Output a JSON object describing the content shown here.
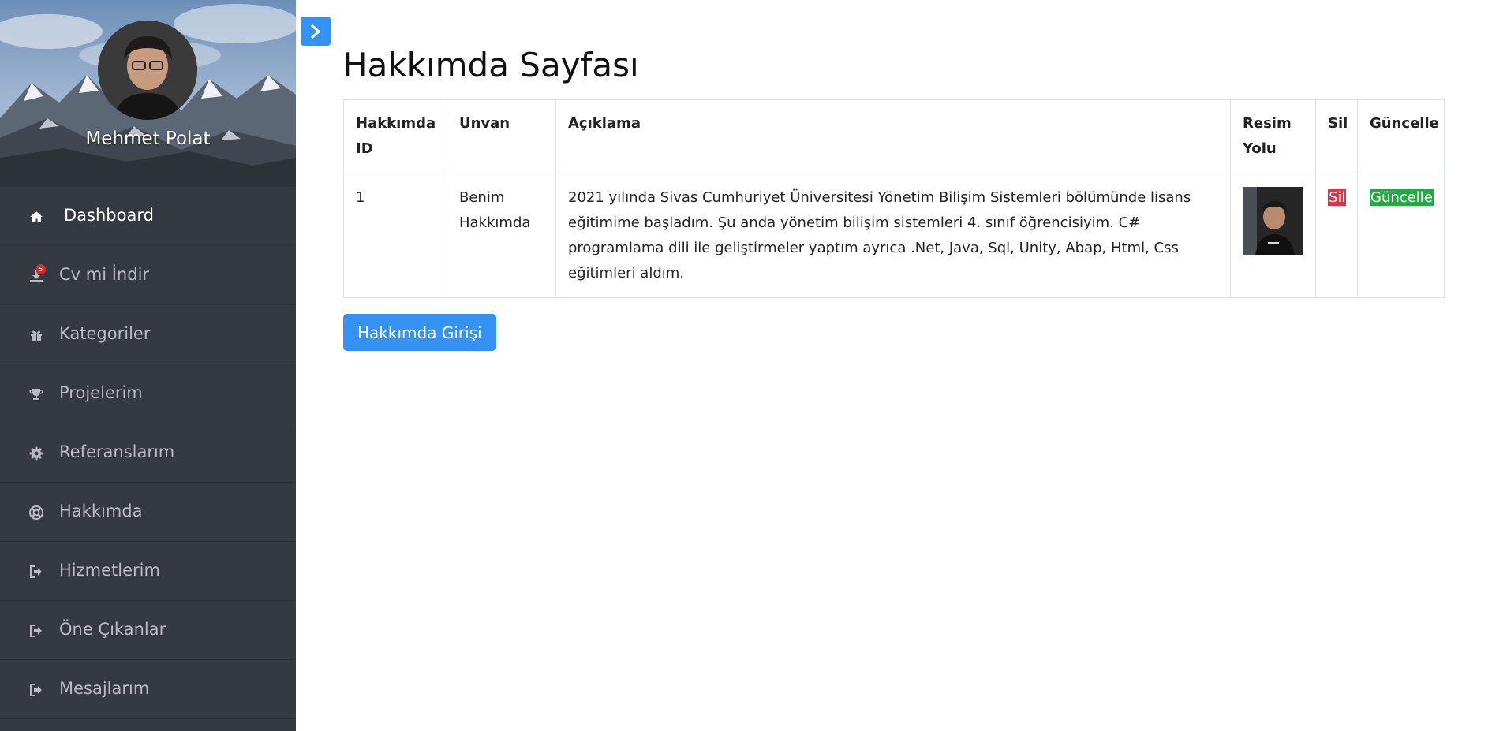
{
  "sidebar": {
    "profile_name": "Mehmet Polat",
    "items": [
      {
        "label": "Dashboard",
        "icon": "home-icon",
        "active": true
      },
      {
        "label": "Cv mi İndir",
        "icon": "download-icon",
        "badge": "5"
      },
      {
        "label": "Kategoriler",
        "icon": "gift-icon"
      },
      {
        "label": "Projelerim",
        "icon": "trophy-icon"
      },
      {
        "label": "Referanslarım",
        "icon": "gear-icon"
      },
      {
        "label": "Hakkımda",
        "icon": "life-ring-icon"
      },
      {
        "label": "Hizmetlerim",
        "icon": "sign-out-icon"
      },
      {
        "label": "Öne Çıkanlar",
        "icon": "sign-out-icon"
      },
      {
        "label": "Mesajlarım",
        "icon": "sign-out-icon"
      }
    ]
  },
  "main": {
    "title": "Hakkımda Sayfası",
    "table": {
      "headers": [
        "Hakkımda ID",
        "Unvan",
        "Açıklama",
        "Resim Yolu",
        "Sil",
        "Güncelle"
      ],
      "rows": [
        {
          "id": "1",
          "unvan": "Benim Hakkımda",
          "aciklama": "2021 yılında Sivas Cumhuriyet Üniversitesi Yönetim Bilişim Sistemleri bölümünde lisans eğitimime başladım. Şu anda yönetim bilişim sistemleri 4. sınıf öğrencisiyim. C# programlama dili ile geliştirmeler yaptım ayrıca .Net, Java, Sql, Unity, Abap, Html, Css eğitimleri aldım.",
          "sil_label": "Sil",
          "guncelle_label": "Güncelle"
        }
      ]
    },
    "add_button_label": "Hakkımda Girişi"
  },
  "colors": {
    "sidebar_bg": "#343a40",
    "primary": "#3592f3",
    "danger": "#dc3545",
    "success": "#28a745"
  }
}
